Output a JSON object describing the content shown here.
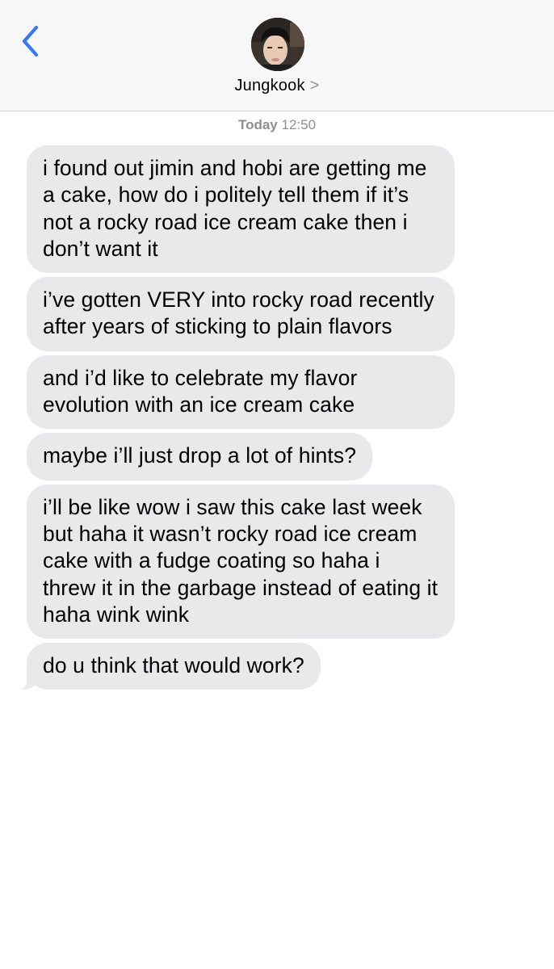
{
  "header": {
    "contact_name": "Jungkook",
    "chevron": ">",
    "back_icon": "chevron-left-icon",
    "accent_color": "#3478f6"
  },
  "thread": {
    "timestamp_day": "Today",
    "timestamp_time": "12:50",
    "messages": [
      {
        "text": "i found out jimin and hobi are getting me a cake, how do i politely tell them if it’s not a rocky road ice cream cake then i don’t want it"
      },
      {
        "text": "i’ve gotten VERY into rocky road recently after years of sticking to plain flavors"
      },
      {
        "text": "and i’d like to celebrate my flavor evolution with an ice cream cake"
      },
      {
        "text": "maybe i’ll just drop a lot of hints?"
      },
      {
        "text": "i’ll be like wow i saw this cake last week but haha it wasn’t rocky road ice cream cake with a fudge coating so haha i threw it in the garbage instead of eating it haha wink wink"
      },
      {
        "text": "do u think that would work?"
      }
    ]
  }
}
